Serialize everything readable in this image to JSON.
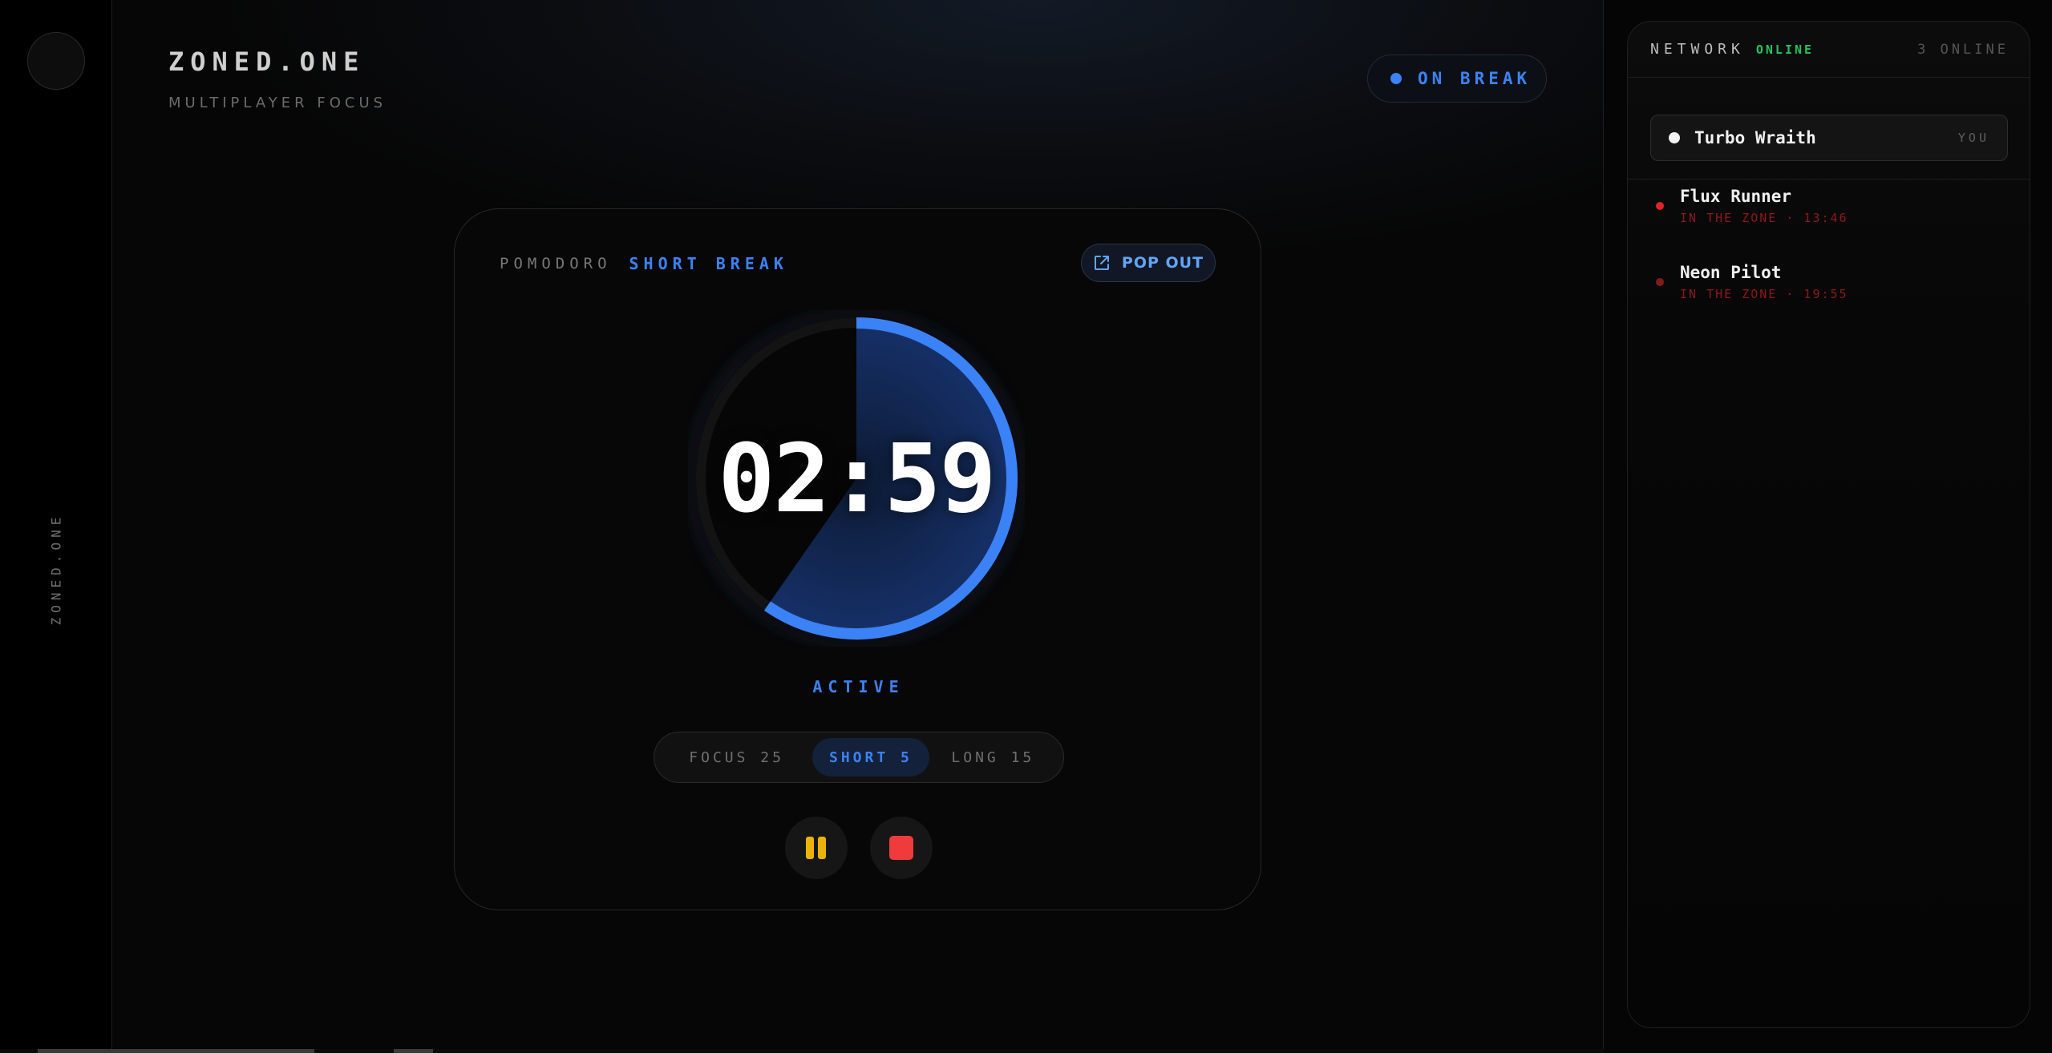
{
  "rail": {
    "brand_vertical": "ZONED.ONE"
  },
  "header": {
    "title": "ZONED.ONE",
    "subtitle": "MULTIPLAYER FOCUS",
    "status": "ON BREAK"
  },
  "timer": {
    "mode_label": "POMODORO",
    "mode_value": "SHORT BREAK",
    "popout_label": "POP OUT",
    "time": "02:59",
    "state": "ACTIVE",
    "remaining_fraction": 0.597,
    "segments": [
      {
        "label": "FOCUS 25",
        "selected": false
      },
      {
        "label": "SHORT 5",
        "selected": true
      },
      {
        "label": "LONG 15",
        "selected": false
      }
    ],
    "pause_icon": "pause-icon",
    "stop_icon": "stop-icon"
  },
  "network": {
    "label": "NETWORK",
    "status": "ONLINE",
    "count": "3 ONLINE",
    "self": {
      "name": "Turbo Wraith",
      "tag": "YOU"
    },
    "peers": [
      {
        "name": "Flux Runner",
        "status": "IN THE ZONE · 13:46"
      },
      {
        "name": "Neon Pilot",
        "status": "IN THE ZONE · 19:55"
      }
    ]
  },
  "colors": {
    "accent": "#3b82f6",
    "online": "#22c55e",
    "pause": "#eab308",
    "stop": "#ef3b3b",
    "zone": "#8b1a1a"
  }
}
